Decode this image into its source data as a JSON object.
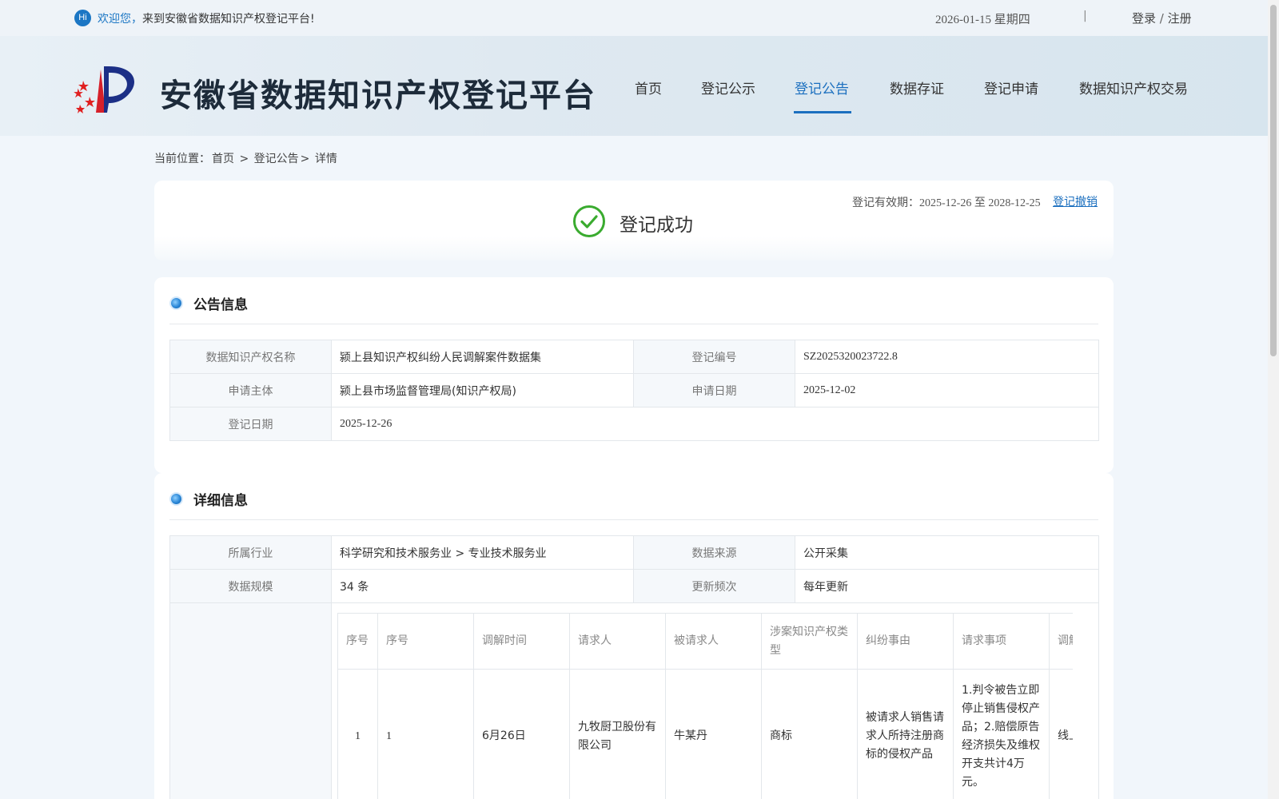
{
  "topbar": {
    "hi_badge": "Hi",
    "welcome_highlight": "欢迎您，",
    "welcome_rest": "来到安徽省数据知识产权登记平台!",
    "date": "2026-01-15 星期四",
    "separator": "|",
    "login": "登录",
    "slash": " / ",
    "register": "注册"
  },
  "header": {
    "site_title": "安徽省数据知识产权登记平台",
    "nav": [
      {
        "label": "首页"
      },
      {
        "label": "登记公示"
      },
      {
        "label": "登记公告"
      },
      {
        "label": "数据存证"
      },
      {
        "label": "登记申请"
      },
      {
        "label": "数据知识产权交易"
      }
    ],
    "active_nav": "登记公告"
  },
  "breadcrumb": {
    "prefix": "当前位置：",
    "home": "首页",
    "gt1": " > ",
    "section": "登记公告",
    "gt2": "> ",
    "current": "详情"
  },
  "status": {
    "text": "登记成功",
    "validity_label": "登记有效期：",
    "validity_range": "2025-12-26 至 2028-12-25",
    "revoke": "登记撤销"
  },
  "announce": {
    "title": "公告信息",
    "rows": [
      {
        "l1": "数据知识产权名称",
        "v1": "颍上县知识产权纠纷人民调解案件数据集",
        "l2": "登记编号",
        "v2": "SZ2025320023722.8"
      },
      {
        "l1": "申请主体",
        "v1": "颍上县市场监督管理局(知识产权局)",
        "l2": "申请日期",
        "v2": "2025-12-02"
      },
      {
        "l1": "登记日期",
        "v1": "2025-12-26"
      }
    ]
  },
  "detail": {
    "title": "详细信息",
    "rows": [
      {
        "l1": "所属行业",
        "v1": "科学研究和技术服务业 > 专业技术服务业",
        "l2": "数据来源",
        "v2": "公开采集"
      },
      {
        "l1": "数据规模",
        "v1": "34 条",
        "l2": "更新频次",
        "v2": "每年更新"
      }
    ],
    "sample_table": {
      "headers": [
        "序号",
        "序号",
        "调解时间",
        "请求人",
        "被请求人",
        "涉案知识产权类型",
        "纠纷事由",
        "请求事项",
        "调解"
      ],
      "rows": [
        [
          "1",
          "1",
          "6月26日",
          "九牧厨卫股份有限公司",
          "牛某丹",
          "商标",
          "被请求人销售请求人所持注册商标的侵权产品",
          "1.判令被告立即停止销售侵权产品；2.赔偿原告经济损失及维权开支共计4万元。",
          "线上"
        ]
      ]
    }
  },
  "colors": {
    "accent": "#1b6fbf",
    "success": "#3aab2f",
    "page_bg": "#f1f6fb"
  }
}
